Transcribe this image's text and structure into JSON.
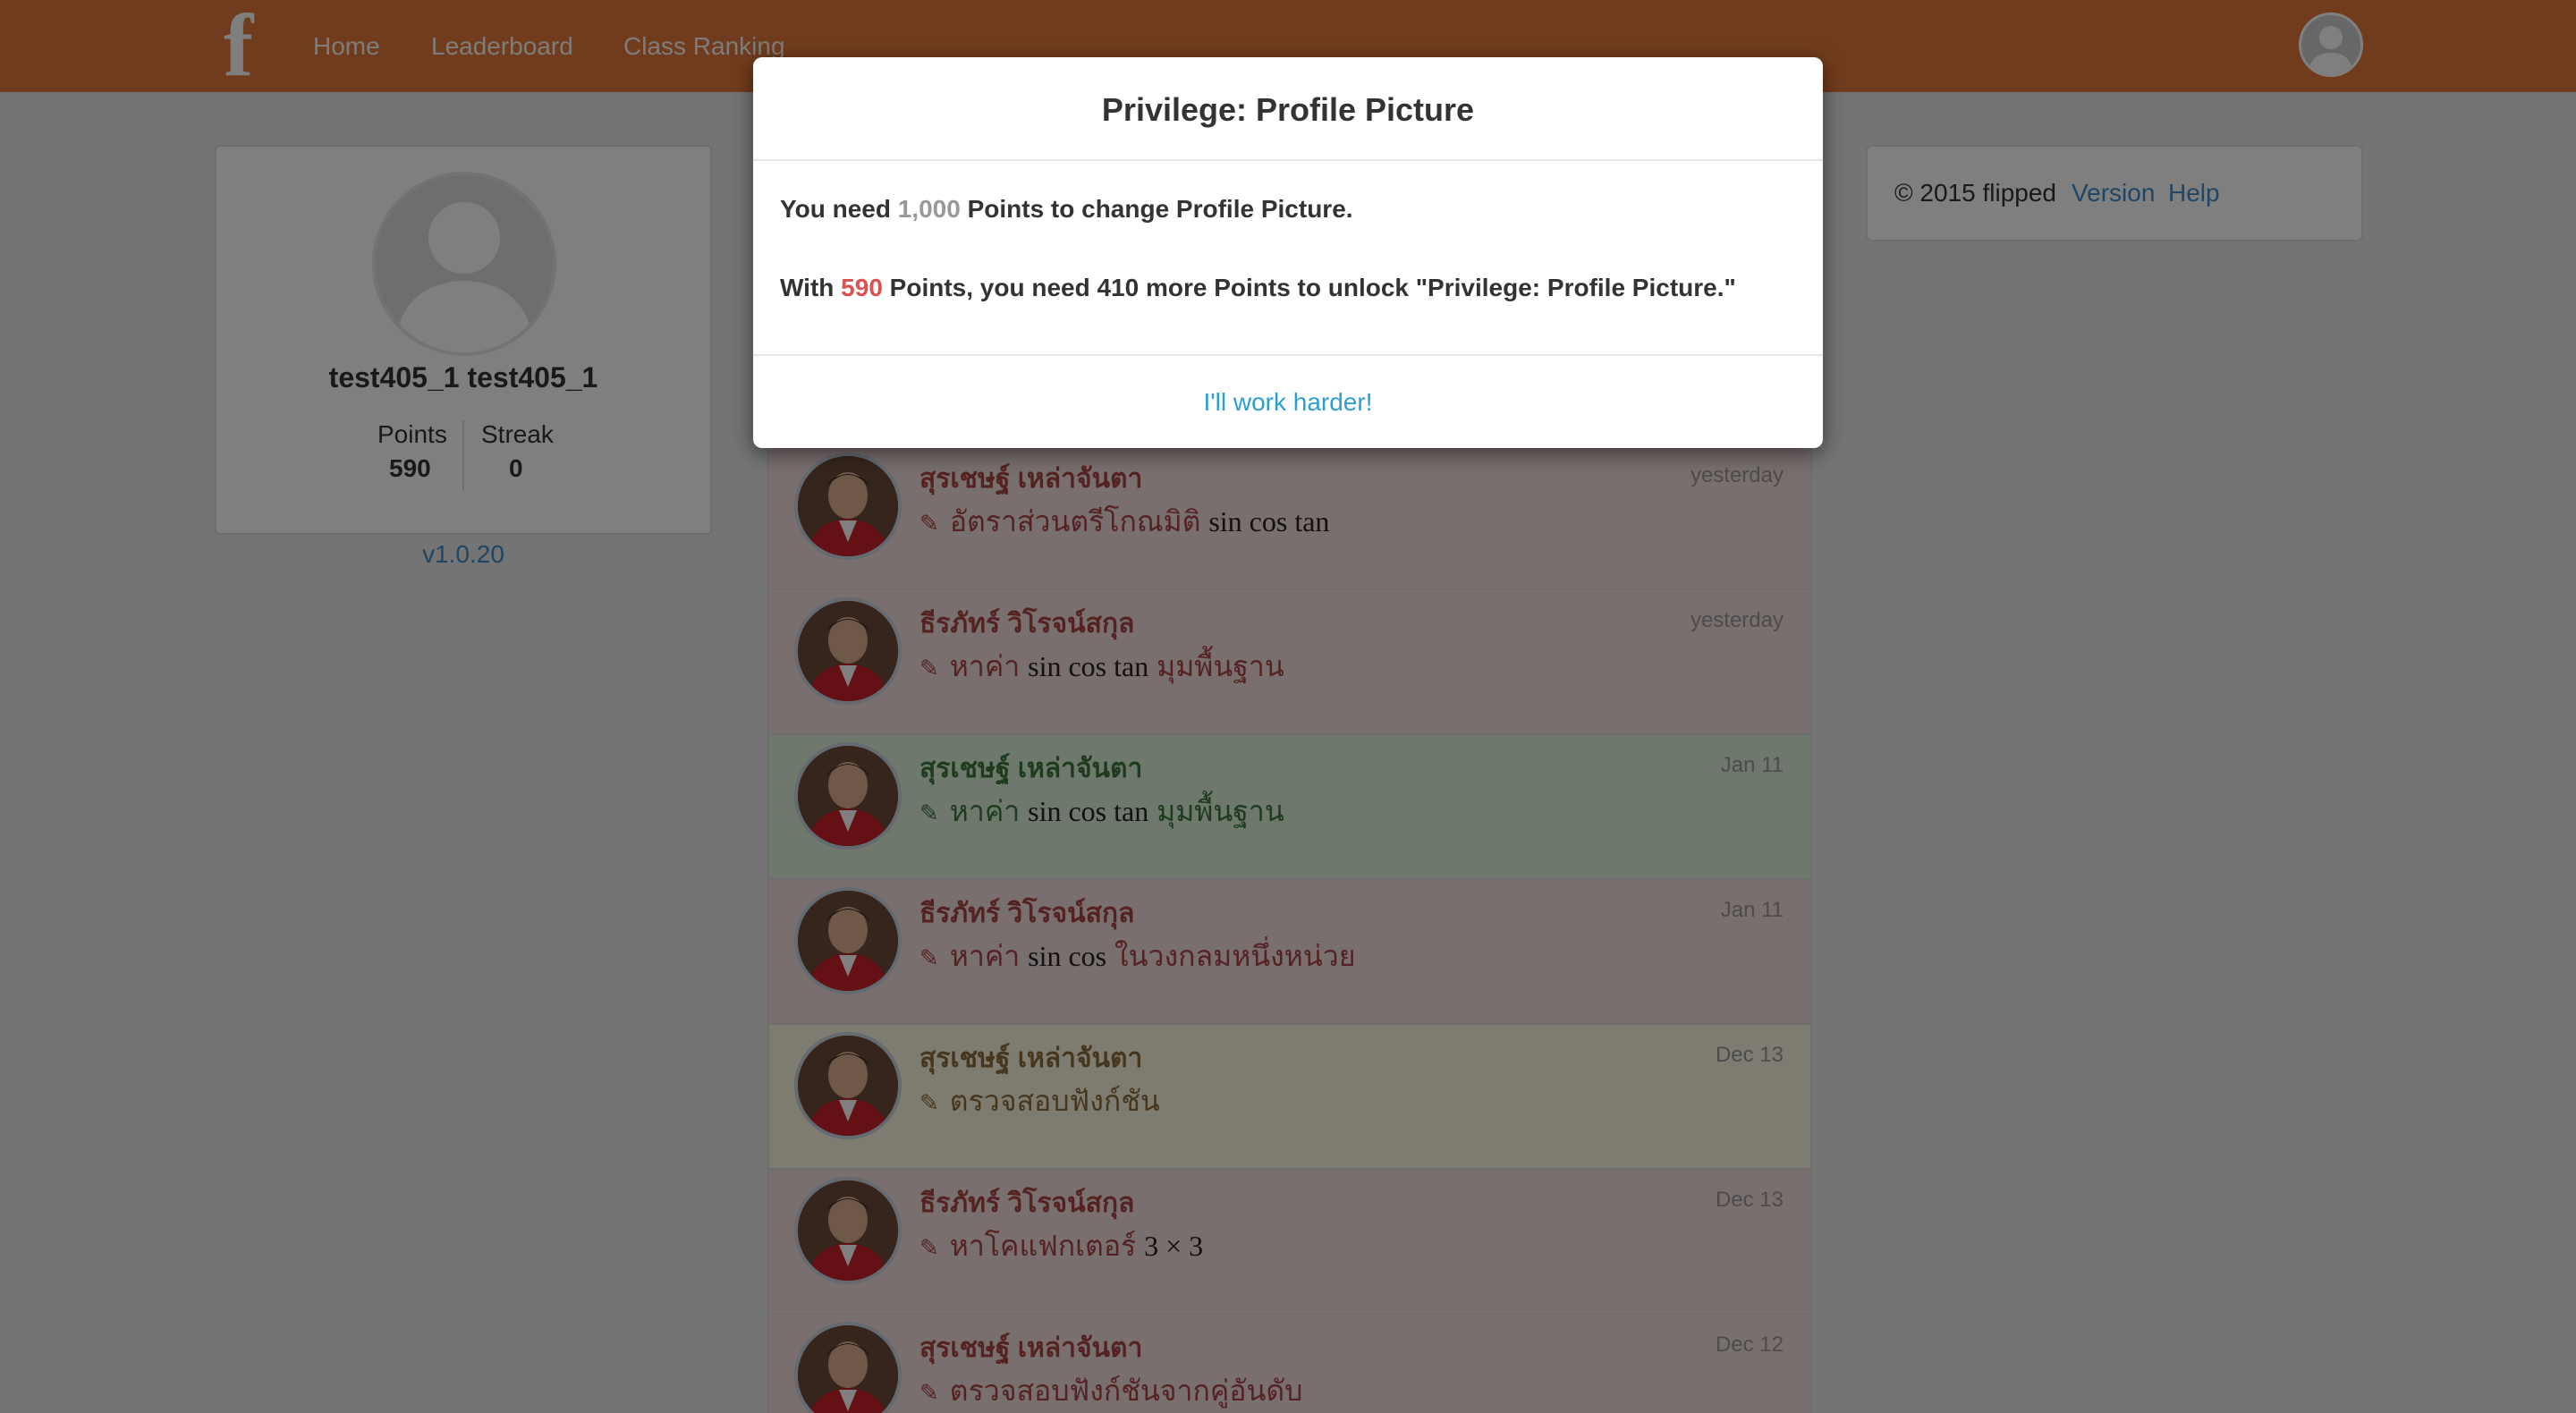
{
  "navbar": {
    "logo": "f",
    "links": [
      "Home",
      "Leaderboard",
      "Class Ranking"
    ]
  },
  "profile": {
    "name": "test405_1 test405_1",
    "points_label": "Points",
    "points_value": "590",
    "streak_label": "Streak",
    "streak_value": "0",
    "version": "v1.0.20"
  },
  "footer": {
    "copyright": "© 2015 flipped",
    "version_link": "Version",
    "help_link": "Help"
  },
  "feed": [
    {
      "name": "สุรเชษฐ์ เหล่าจันตา",
      "text_pre": "อัตราส่วนตรีโกณมิติ",
      "math": "sin cos tan",
      "text_post": "",
      "date": "yesterday",
      "status": "red"
    },
    {
      "name": "ธีรภัทร์ วิโรจน์สกุล",
      "text_pre": "หาค่า",
      "math": "sin cos tan",
      "text_post": "มุมพื้นฐาน",
      "date": "yesterday",
      "status": "red"
    },
    {
      "name": "สุรเชษฐ์ เหล่าจันตา",
      "text_pre": "หาค่า",
      "math": "sin cos tan",
      "text_post": "มุมพื้นฐาน",
      "date": "Jan 11",
      "status": "green"
    },
    {
      "name": "ธีรภัทร์ วิโรจน์สกุล",
      "text_pre": "หาค่า",
      "math": "sin cos",
      "text_post": "ในวงกลมหนึ่งหน่วย",
      "date": "Jan 11",
      "status": "red"
    },
    {
      "name": "สุรเชษฐ์ เหล่าจันตา",
      "text_pre": "ตรวจสอบฟังก์ชัน",
      "math": "",
      "text_post": "",
      "date": "Dec 13",
      "status": "yellow"
    },
    {
      "name": "ธีรภัทร์ วิโรจน์สกุล",
      "text_pre": "หาโคแฟกเตอร์",
      "math": "3 × 3",
      "text_post": "",
      "date": "Dec 13",
      "status": "red"
    },
    {
      "name": "สุรเชษฐ์ เหล่าจันตา",
      "text_pre": "ตรวจสอบฟังก์ชันจากคู่อันดับ",
      "math": "",
      "text_post": "",
      "date": "Dec 12",
      "status": "red"
    }
  ],
  "modal": {
    "title": "Privilege: Profile Picture",
    "line1_a": "You need ",
    "line1_points": "1,000",
    "line1_b": " Points to change Profile Picture.",
    "line2_a": "With ",
    "line2_points": "590",
    "line2_b": " Points, you need 410 more Points to unlock \"Privilege: Profile Picture.\"",
    "button": "I'll work harder!"
  },
  "colors": {
    "navbar": "#e2793a",
    "link": "#428bca",
    "modal_button": "#2a9fd6",
    "red_row": "#f2dede",
    "green_row": "#dff0d8",
    "yellow_row": "#fcf8e3"
  }
}
